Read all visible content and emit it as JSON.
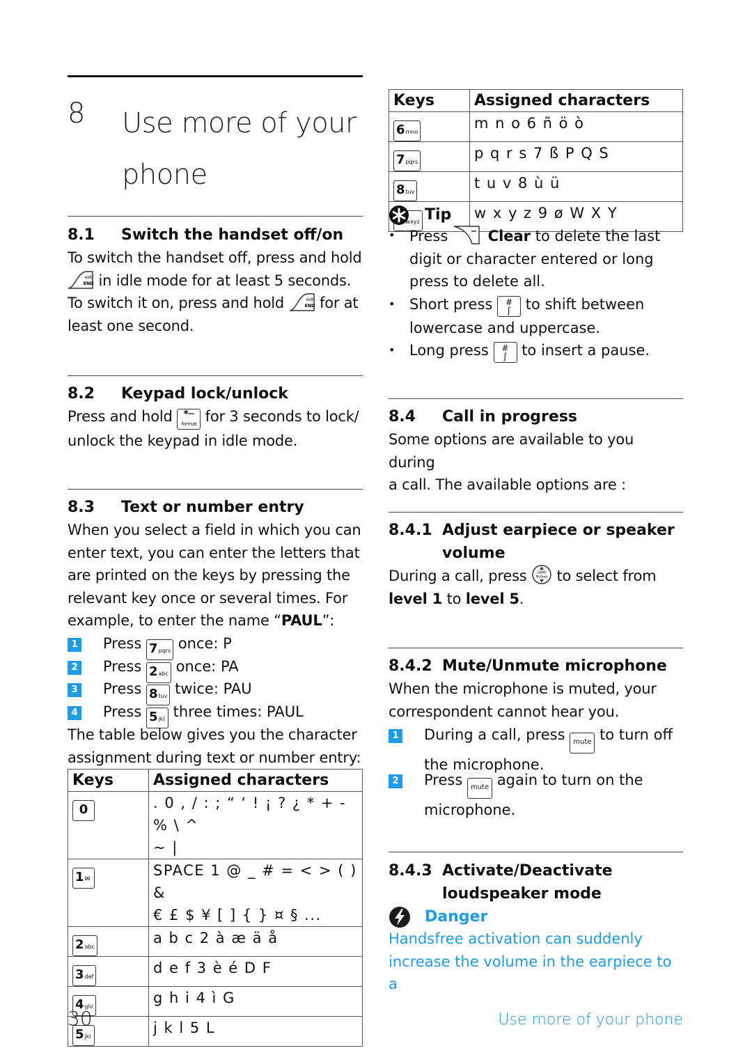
{
  "chapter": {
    "number": "8",
    "title": "Use more of your phone"
  },
  "s81": {
    "num": "8.1",
    "title": "Switch the handset off/on",
    "line1": "To switch the handset off, press and hold",
    "line2": "in idle mode for at least 5 seconds.",
    "line3a": "To switch it on, press and hold",
    "line3b": "for at",
    "line4": "least one second.",
    "key_icon": "end-key-icon",
    "key_top": "exit",
    "key_bottom": "END"
  },
  "s82": {
    "num": "8.2",
    "title": "Keypad lock/unlock",
    "line1a": "Press and hold",
    "line1b": "for 3 seconds to lock/",
    "line2": "unlock the keypad in idle mode.",
    "key_main": "*",
    "key_sub": "format"
  },
  "s83": {
    "num": "8.3",
    "title": "Text or number entry",
    "para": [
      "When you select a field in which you can",
      "enter text, you can enter the letters that",
      "are printed on the keys by pressing the",
      "relevant key once or several times. For"
    ],
    "example_pre": "example, to enter the name “",
    "example_name": "PAUL",
    "example_post": "”:",
    "steps": [
      {
        "n": "1",
        "pre": "Press",
        "key": "7",
        "sub": "pqrs",
        "post": "once: P"
      },
      {
        "n": "2",
        "pre": "Press",
        "key": "2",
        "sub": "abc",
        "post": "once: PA"
      },
      {
        "n": "3",
        "pre": "Press",
        "key": "8",
        "sub": "tuv",
        "post": "twice: PAU"
      },
      {
        "n": "4",
        "pre": "Press",
        "key": "5",
        "sub": "jkl",
        "post": "three times: PAUL"
      }
    ],
    "table_intro": [
      "The table below gives you the character",
      "assignment during text or number entry:"
    ]
  },
  "table_left": {
    "headers": [
      "Keys",
      "Assigned characters"
    ],
    "rows": [
      {
        "key": "0",
        "sub": "",
        "chars": [
          ". 0 , / : ;  “ ‘ ! ¡ ? ¿ * + - % \\ ^",
          "~ |"
        ]
      },
      {
        "key": "1",
        "sub": "✉",
        "chars": [
          "SPACE 1 @ _ # = < > ( ) &",
          "€ £ $ ¥ [ ] { } ¤ § ..."
        ]
      },
      {
        "key": "2",
        "sub": "abc",
        "chars": [
          "a b c 2 à æ ä å"
        ]
      },
      {
        "key": "3",
        "sub": "def",
        "chars": [
          "d e f 3 è é D F"
        ]
      },
      {
        "key": "4",
        "sub": "ghi",
        "chars": [
          "g h i 4 ì G"
        ]
      },
      {
        "key": "5",
        "sub": "jkl",
        "chars": [
          "j k l 5 L"
        ]
      }
    ]
  },
  "table_right": {
    "headers": [
      "Keys",
      "Assigned characters"
    ],
    "rows": [
      {
        "key": "6",
        "sub": "mno",
        "chars": [
          "m n o 6 ñ ö ò"
        ]
      },
      {
        "key": "7",
        "sub": "pqrs",
        "chars": [
          "p q r s 7 ß P Q S"
        ]
      },
      {
        "key": "8",
        "sub": "tuv",
        "chars": [
          "t u v 8 ù ü"
        ]
      },
      {
        "key": "9",
        "sub": "wxyz",
        "chars": [
          "w x y z 9 ø W X Y"
        ]
      }
    ]
  },
  "tip": {
    "title": "Tip",
    "b1_pre": "Press",
    "b1_bold": "Clear",
    "b1_post": "to delete the last",
    "b1_l2": "digit or character entered or long",
    "b1_l3": "press to delete all.",
    "b2_pre": "Short press",
    "b2_post": "to shift between",
    "b2_l2": "lowercase and uppercase.",
    "b3_pre": "Long press",
    "b3_post": "to insert a pause.",
    "hash_key_top": "#",
    "hash_key_bottom": "ʃ"
  },
  "s84": {
    "num": "8.4",
    "title": "Call in progress",
    "line1": "Some options are available to you during",
    "line2": "a call. The available options are :"
  },
  "s841": {
    "num": "8.4.1",
    "title": "Adjust earpiece or speaker volume",
    "line1a": "During a call, press",
    "line1b": "to select from",
    "level1": "level 1",
    "to": "to",
    "level5": "level 5",
    "dot": ".",
    "nav_top": "callID",
    "nav_bottom": "Ph.Book"
  },
  "s842": {
    "num": "8.4.2",
    "title": "Mute/Unmute microphone",
    "line1": "When the microphone is muted, your",
    "line2": "correspondent cannot hear you.",
    "key_label": "mute",
    "steps": [
      {
        "n": "1",
        "pre": "During a call, press",
        "post": "to turn off",
        "l2": "the microphone."
      },
      {
        "n": "2",
        "pre": "Press",
        "post": "again to turn on the",
        "l2": "microphone."
      }
    ]
  },
  "s843": {
    "num": "8.4.3",
    "title": "Activate/Deactivate loudspeaker mode",
    "danger_title": "Danger",
    "danger_lines": [
      "Handsfree activation can suddenly",
      "increase the volume in the earpiece to a"
    ]
  },
  "footer": {
    "page_number": "30",
    "section_title": "Use more of your phone"
  },
  "colors": {
    "accent": "#1e9be9",
    "text": "#111111"
  }
}
